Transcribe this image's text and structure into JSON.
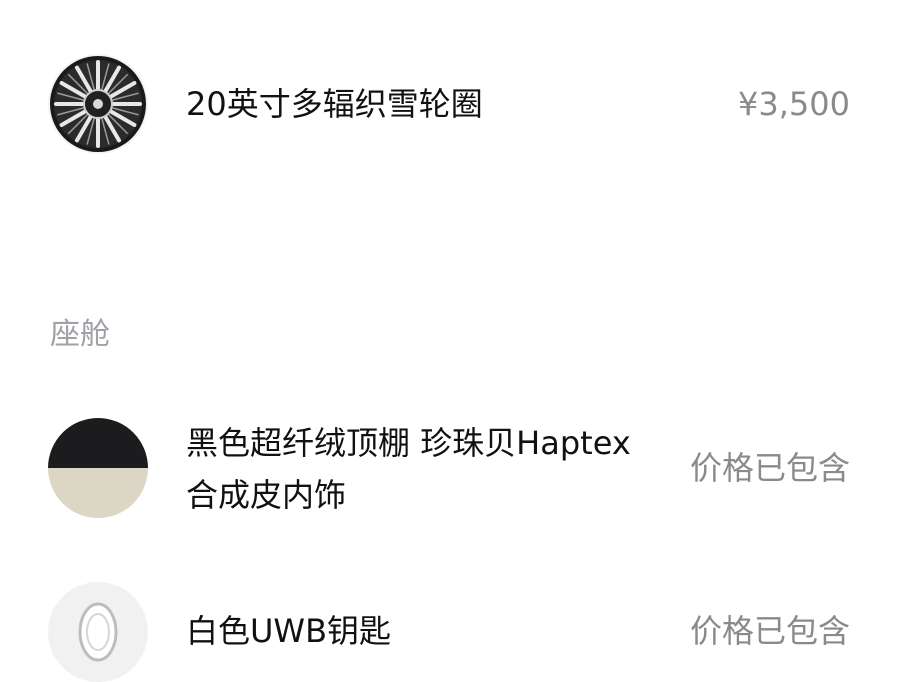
{
  "wheels": {
    "name": "20英寸多辐织雪轮圈",
    "price": "¥3,500",
    "icon": "wheel-image"
  },
  "cabin_section": {
    "title": "座舱"
  },
  "interior": {
    "name_line1": "黑色超纤绒顶棚 珍珠贝Haptex",
    "name_line2": "合成皮内饰",
    "price": "价格已包含",
    "icon": "interior-swatch-image",
    "colors": {
      "headliner": "#1c1c1e",
      "trim": "#dcd6c4"
    }
  },
  "key": {
    "name": "白色UWB钥匙",
    "price": "价格已包含",
    "icon": "uwb-key-image"
  }
}
